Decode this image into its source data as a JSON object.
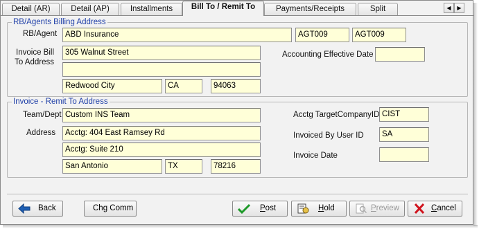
{
  "tabs": [
    {
      "label": "Detail (AR)"
    },
    {
      "label": "Detail (AP)"
    },
    {
      "label": "Installments"
    },
    {
      "label": "Bill To / Remit To"
    },
    {
      "label": "Payments/Receipts"
    },
    {
      "label": "Split"
    }
  ],
  "billing": {
    "title": "RB/Agents Billing Address",
    "rb_agent_label": "RB/Agent",
    "rb_agent_name": "ABD Insurance",
    "rb_agent_code1": "AGT009",
    "rb_agent_code2": "AGT009",
    "invoice_bill_label_1": "Invoice Bill",
    "invoice_bill_label_2": "To Address",
    "address_line1": "305 Walnut Street",
    "address_line2": "",
    "city": "Redwood City",
    "state": "CA",
    "zip": "94063",
    "accounting_effective_date_label": "Accounting Effective Date",
    "accounting_effective_date": ""
  },
  "remit": {
    "title": "Invoice - Remit To Address",
    "team_label": "Team/Dept",
    "team": "Custom INS Team",
    "address_label": "Address",
    "address_line1": "Acctg: 404 East Ramsey Rd",
    "address_line2": "Acctg: Suite 210",
    "city": "San Antonio",
    "state": "TX",
    "zip": "78216",
    "target_company_label": "Acctg TargetCompanyID",
    "target_company": "CIST",
    "invoiced_by_label": "Invoiced By User ID",
    "invoiced_by": "SA",
    "invoice_date_label": "Invoice Date",
    "invoice_date": ""
  },
  "buttons": {
    "back": "Back",
    "chg_comm": "Chg Comm",
    "post_u": "P",
    "post_rest": "ost",
    "hold_u": "H",
    "hold_rest": "old",
    "preview_u": "P",
    "preview_rest": "review",
    "cancel_u": "C",
    "cancel_rest": "ancel"
  },
  "colors": {
    "field_bg": "#ffffd8",
    "group_title": "#1f3fa8",
    "back_arrow": "#1e5fb4",
    "post_check": "#1f9a2a",
    "cancel_x": "#d0141e"
  },
  "icons": [
    "arrow-left-icon",
    "checkmark-icon",
    "hold-document-icon",
    "preview-magnifier-icon",
    "red-x-icon",
    "scroll-left-icon",
    "scroll-right-icon"
  ]
}
